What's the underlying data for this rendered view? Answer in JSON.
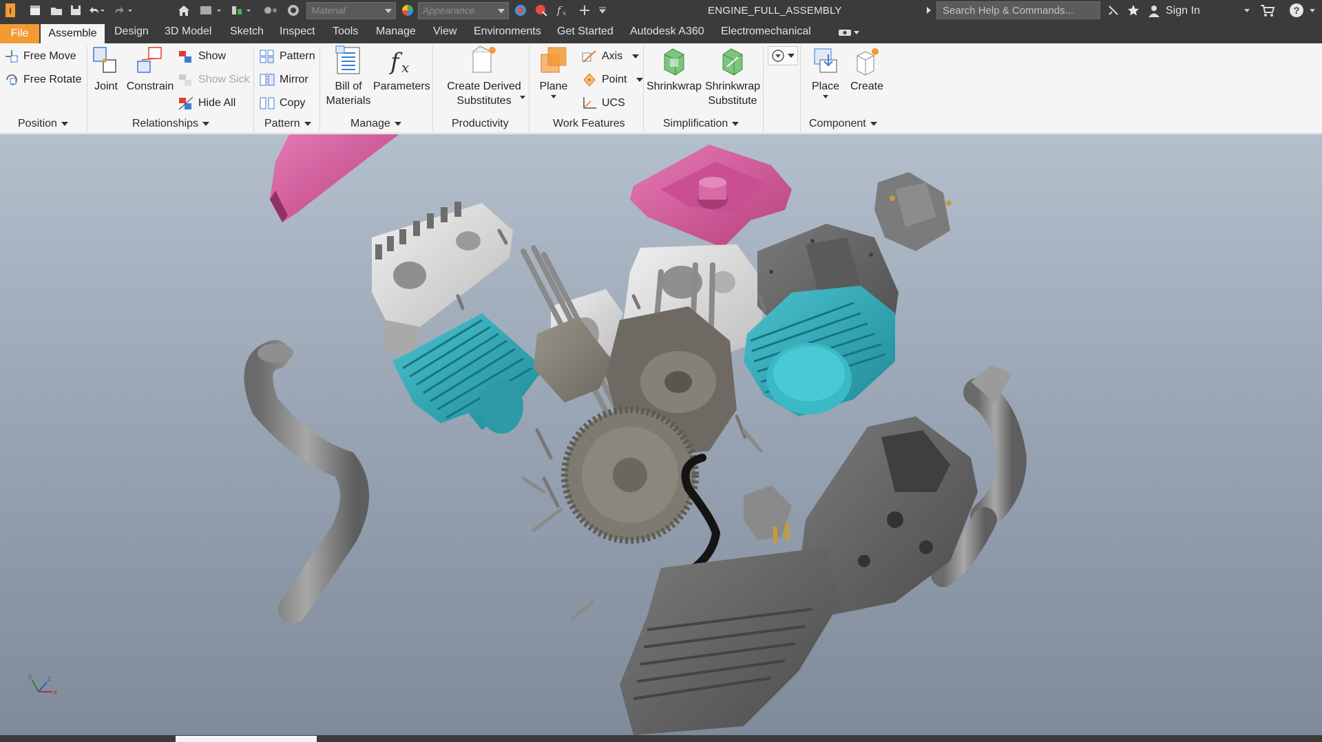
{
  "titlebar": {
    "document_title": "ENGINE_FULL_ASSEMBLY",
    "material_placeholder": "Material",
    "appearance_placeholder": "Appearance",
    "search_placeholder": "Search Help & Commands...",
    "signin_label": "Sign In"
  },
  "tabs": [
    {
      "label": "File"
    },
    {
      "label": "Assemble"
    },
    {
      "label": "Design"
    },
    {
      "label": "3D Model"
    },
    {
      "label": "Sketch"
    },
    {
      "label": "Inspect"
    },
    {
      "label": "Tools"
    },
    {
      "label": "Manage"
    },
    {
      "label": "View"
    },
    {
      "label": "Environments"
    },
    {
      "label": "Get Started"
    },
    {
      "label": "Autodesk A360"
    },
    {
      "label": "Electromechanical"
    }
  ],
  "ribbon": {
    "position": {
      "title": "Position",
      "free_move": "Free Move",
      "free_rotate": "Free Rotate"
    },
    "relationships": {
      "title": "Relationships",
      "joint": "Joint",
      "constrain": "Constrain",
      "show": "Show",
      "show_sick": "Show Sick",
      "hide_all": "Hide All"
    },
    "pattern": {
      "title": "Pattern",
      "pattern": "Pattern",
      "mirror": "Mirror",
      "copy": "Copy"
    },
    "manage": {
      "title": "Manage",
      "bill_line1": "Bill of",
      "bill_line2": "Materials",
      "parameters": "Parameters"
    },
    "productivity": {
      "title": "Productivity",
      "line1": "Create Derived",
      "line2": "Substitutes"
    },
    "work_features": {
      "title": "Work Features",
      "plane": "Plane",
      "axis": "Axis",
      "point": "Point",
      "ucs": "UCS"
    },
    "simplification": {
      "title": "Simplification",
      "shrinkwrap": "Shrinkwrap",
      "sub_line1": "Shrinkwrap",
      "sub_line2": "Substitute"
    },
    "component": {
      "title": "Component",
      "place": "Place",
      "create": "Create"
    }
  },
  "colors": {
    "titlebar_bg": "#3b3b3b",
    "file_tab": "#f39a34",
    "ribbon_bg": "#f5f5f5",
    "part_pink": "#d85a9e",
    "part_cyan": "#2aa7b5",
    "part_grey": "#6c6c6c",
    "part_white": "#dcdcdc"
  },
  "icons": [
    "app-logo-icon",
    "new-icon",
    "open-icon",
    "save-icon",
    "undo-icon",
    "redo-icon",
    "home-icon",
    "select-icon",
    "measure-icon",
    "color-icon",
    "fx-icon",
    "plus-icon",
    "star-icon",
    "cart-icon",
    "help-icon",
    "user-icon"
  ]
}
